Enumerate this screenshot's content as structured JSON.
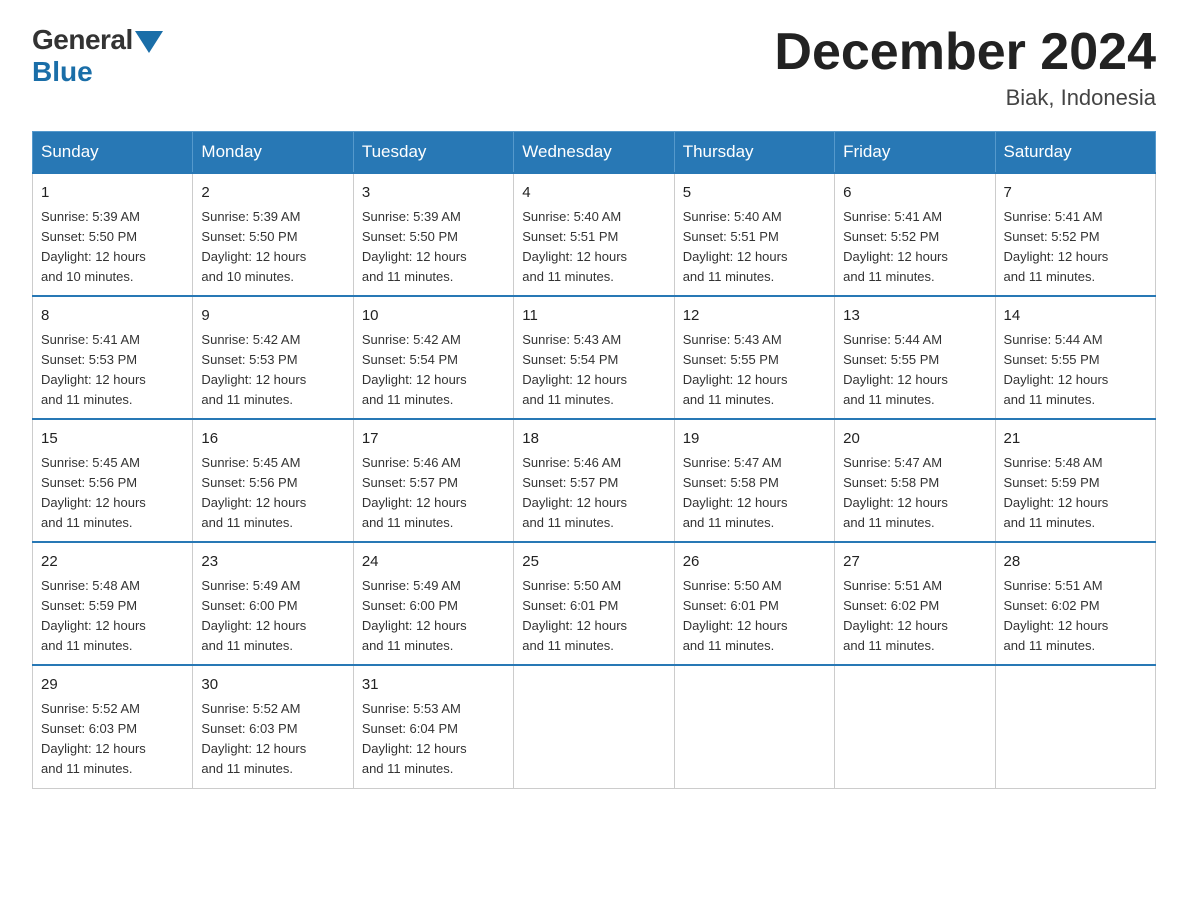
{
  "logo": {
    "general": "General",
    "blue": "Blue"
  },
  "header": {
    "month_year": "December 2024",
    "location": "Biak, Indonesia"
  },
  "days_of_week": [
    "Sunday",
    "Monday",
    "Tuesday",
    "Wednesday",
    "Thursday",
    "Friday",
    "Saturday"
  ],
  "weeks": [
    [
      {
        "day": "1",
        "sunrise": "5:39 AM",
        "sunset": "5:50 PM",
        "daylight": "12 hours and 10 minutes."
      },
      {
        "day": "2",
        "sunrise": "5:39 AM",
        "sunset": "5:50 PM",
        "daylight": "12 hours and 10 minutes."
      },
      {
        "day": "3",
        "sunrise": "5:39 AM",
        "sunset": "5:50 PM",
        "daylight": "12 hours and 11 minutes."
      },
      {
        "day": "4",
        "sunrise": "5:40 AM",
        "sunset": "5:51 PM",
        "daylight": "12 hours and 11 minutes."
      },
      {
        "day": "5",
        "sunrise": "5:40 AM",
        "sunset": "5:51 PM",
        "daylight": "12 hours and 11 minutes."
      },
      {
        "day": "6",
        "sunrise": "5:41 AM",
        "sunset": "5:52 PM",
        "daylight": "12 hours and 11 minutes."
      },
      {
        "day": "7",
        "sunrise": "5:41 AM",
        "sunset": "5:52 PM",
        "daylight": "12 hours and 11 minutes."
      }
    ],
    [
      {
        "day": "8",
        "sunrise": "5:41 AM",
        "sunset": "5:53 PM",
        "daylight": "12 hours and 11 minutes."
      },
      {
        "day": "9",
        "sunrise": "5:42 AM",
        "sunset": "5:53 PM",
        "daylight": "12 hours and 11 minutes."
      },
      {
        "day": "10",
        "sunrise": "5:42 AM",
        "sunset": "5:54 PM",
        "daylight": "12 hours and 11 minutes."
      },
      {
        "day": "11",
        "sunrise": "5:43 AM",
        "sunset": "5:54 PM",
        "daylight": "12 hours and 11 minutes."
      },
      {
        "day": "12",
        "sunrise": "5:43 AM",
        "sunset": "5:55 PM",
        "daylight": "12 hours and 11 minutes."
      },
      {
        "day": "13",
        "sunrise": "5:44 AM",
        "sunset": "5:55 PM",
        "daylight": "12 hours and 11 minutes."
      },
      {
        "day": "14",
        "sunrise": "5:44 AM",
        "sunset": "5:55 PM",
        "daylight": "12 hours and 11 minutes."
      }
    ],
    [
      {
        "day": "15",
        "sunrise": "5:45 AM",
        "sunset": "5:56 PM",
        "daylight": "12 hours and 11 minutes."
      },
      {
        "day": "16",
        "sunrise": "5:45 AM",
        "sunset": "5:56 PM",
        "daylight": "12 hours and 11 minutes."
      },
      {
        "day": "17",
        "sunrise": "5:46 AM",
        "sunset": "5:57 PM",
        "daylight": "12 hours and 11 minutes."
      },
      {
        "day": "18",
        "sunrise": "5:46 AM",
        "sunset": "5:57 PM",
        "daylight": "12 hours and 11 minutes."
      },
      {
        "day": "19",
        "sunrise": "5:47 AM",
        "sunset": "5:58 PM",
        "daylight": "12 hours and 11 minutes."
      },
      {
        "day": "20",
        "sunrise": "5:47 AM",
        "sunset": "5:58 PM",
        "daylight": "12 hours and 11 minutes."
      },
      {
        "day": "21",
        "sunrise": "5:48 AM",
        "sunset": "5:59 PM",
        "daylight": "12 hours and 11 minutes."
      }
    ],
    [
      {
        "day": "22",
        "sunrise": "5:48 AM",
        "sunset": "5:59 PM",
        "daylight": "12 hours and 11 minutes."
      },
      {
        "day": "23",
        "sunrise": "5:49 AM",
        "sunset": "6:00 PM",
        "daylight": "12 hours and 11 minutes."
      },
      {
        "day": "24",
        "sunrise": "5:49 AM",
        "sunset": "6:00 PM",
        "daylight": "12 hours and 11 minutes."
      },
      {
        "day": "25",
        "sunrise": "5:50 AM",
        "sunset": "6:01 PM",
        "daylight": "12 hours and 11 minutes."
      },
      {
        "day": "26",
        "sunrise": "5:50 AM",
        "sunset": "6:01 PM",
        "daylight": "12 hours and 11 minutes."
      },
      {
        "day": "27",
        "sunrise": "5:51 AM",
        "sunset": "6:02 PM",
        "daylight": "12 hours and 11 minutes."
      },
      {
        "day": "28",
        "sunrise": "5:51 AM",
        "sunset": "6:02 PM",
        "daylight": "12 hours and 11 minutes."
      }
    ],
    [
      {
        "day": "29",
        "sunrise": "5:52 AM",
        "sunset": "6:03 PM",
        "daylight": "12 hours and 11 minutes."
      },
      {
        "day": "30",
        "sunrise": "5:52 AM",
        "sunset": "6:03 PM",
        "daylight": "12 hours and 11 minutes."
      },
      {
        "day": "31",
        "sunrise": "5:53 AM",
        "sunset": "6:04 PM",
        "daylight": "12 hours and 11 minutes."
      },
      null,
      null,
      null,
      null
    ]
  ],
  "labels": {
    "sunrise": "Sunrise:",
    "sunset": "Sunset:",
    "daylight": "Daylight:"
  }
}
